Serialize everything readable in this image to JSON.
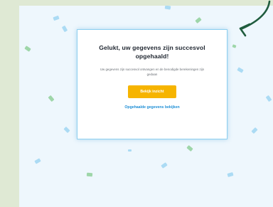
{
  "card": {
    "title": "Gelukt, uw gegevens zijn succesvol opgehaald!",
    "description": "Uw gegevens zijn succesvol ontvangen en de benodigde berekeningen zijn gedaan",
    "primary_button": "Bekijk inzicht",
    "secondary_link": "Opgehaalde gegevens bekijken"
  },
  "colors": {
    "side_panel": "#dfe9d4",
    "page_background": "#eef7fd",
    "card_border": "#8dcff0",
    "primary_button": "#f6b400",
    "link": "#1f8fd6",
    "arrow": "#1f5c3e",
    "confetti_green": "#8fd09a",
    "confetti_blue": "#9fd6f2"
  },
  "decorations": {
    "arrow_icon": "curved-arrow-icon",
    "confetti": "confetti-pieces"
  }
}
